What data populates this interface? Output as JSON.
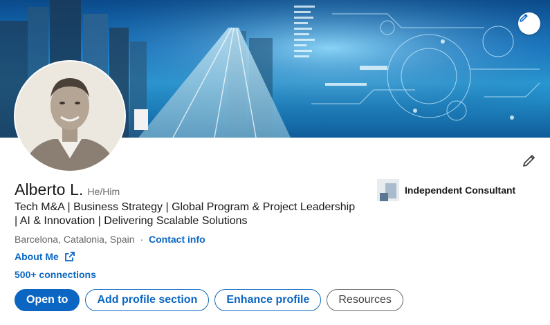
{
  "profile": {
    "name": "Alberto L.",
    "pronouns": "He/Him",
    "headline_line1": "Tech M&A | Business Strategy | Global Program & Project Leadership",
    "headline_line2": "| AI & Innovation | Delivering Scalable Solutions",
    "location": "Barcelona, Catalonia, Spain",
    "separator": "·",
    "contact_info": "Contact info",
    "about_link": "About Me",
    "connections": "500+ connections"
  },
  "current_position": {
    "company": "Independent Consultant"
  },
  "actions": {
    "open_to": "Open to",
    "add_section": "Add profile section",
    "enhance": "Enhance profile",
    "resources": "Resources"
  },
  "icons": {
    "banner_edit": "pencil-icon",
    "profile_edit": "pencil-icon",
    "external_link": "external-link-icon"
  },
  "colors": {
    "accent": "#0a66c2",
    "text_primary": "#191919",
    "text_secondary": "#666666"
  }
}
